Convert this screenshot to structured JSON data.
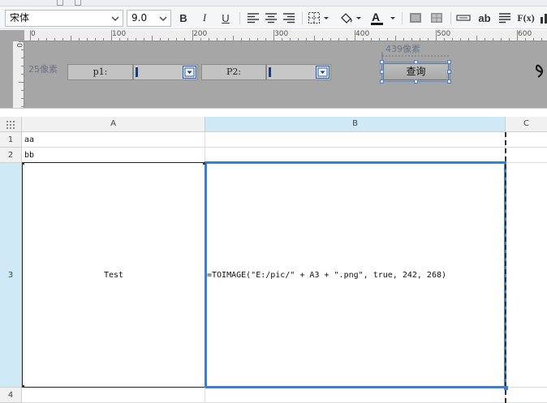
{
  "toolbar": {
    "font_family": "宋体",
    "font_size": "9.0",
    "bold_label": "B",
    "italic_label": "I",
    "underline_label": "U",
    "font_color": "#1a1a1a",
    "text_label": "ab",
    "fx_label": "F(x)",
    "icons": [
      "bold-icon",
      "italic-icon",
      "underline-icon",
      "align-left-icon",
      "align-center-icon",
      "align-right-icon",
      "border-icon",
      "fill-color-icon",
      "font-color-icon",
      "merge-icon",
      "split-icon",
      "text-tool-icon",
      "wrap-icon",
      "formula-icon",
      "chart-icon"
    ]
  },
  "ruler": {
    "marks": [
      "0",
      "100",
      "200",
      "300",
      "400",
      "500",
      "600"
    ],
    "vertical_mark": "0"
  },
  "design": {
    "height_label": "25像素",
    "width_label": "439像素",
    "param1_label": "p1:",
    "param2_label": "P2:",
    "query_button": "查询"
  },
  "grid": {
    "columns": [
      "A",
      "B",
      "C"
    ],
    "rows": [
      "1",
      "2",
      "3",
      "4"
    ],
    "cells": {
      "A1": "aa",
      "A2": "bb",
      "A3": "Test",
      "B3": "=TOIMAGE(\"E:/pic/\" + A3 + \".png\", true, 242, 268)"
    },
    "selected_cell": "B3",
    "selection_color": "#3b80d0"
  }
}
